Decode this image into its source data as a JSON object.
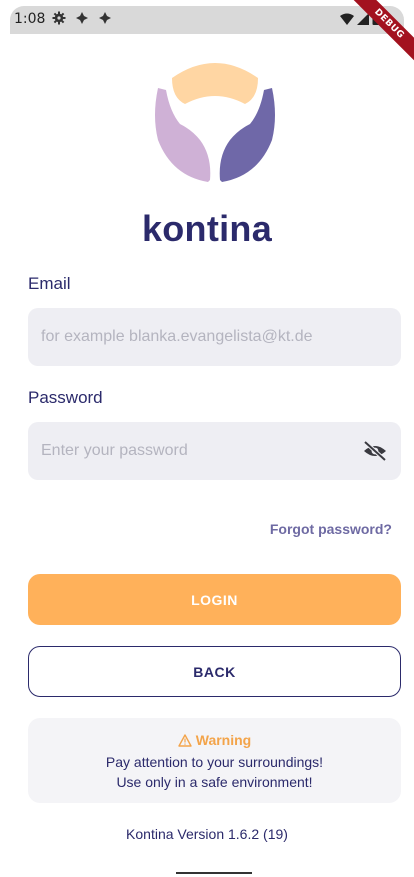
{
  "status_bar": {
    "time": "1:08",
    "debug_label": "DEBUG"
  },
  "app": {
    "brand_name": "kontina"
  },
  "form": {
    "email_label": "Email",
    "email_placeholder": "for example blanka.evangelista@kt.de",
    "email_value": "",
    "password_label": "Password",
    "password_placeholder": "Enter your password",
    "password_value": "",
    "forgot_password": "Forgot password?"
  },
  "actions": {
    "login_label": "LOGIN",
    "back_label": "BACK"
  },
  "warning": {
    "icon": "warning-triangle",
    "title": "Warning",
    "line1": "Pay attention to your surroundings!",
    "line2": "Use only in a safe environment!"
  },
  "footer": {
    "version": "Kontina Version 1.6.2 (19)"
  },
  "colors": {
    "primary": "#2b2a6b",
    "accent": "#ffb15a",
    "input_bg": "#eeeef3",
    "logo_peach": "#ffd6a3",
    "logo_lilac": "#cfb1d6",
    "logo_violet": "#6f68a8"
  }
}
